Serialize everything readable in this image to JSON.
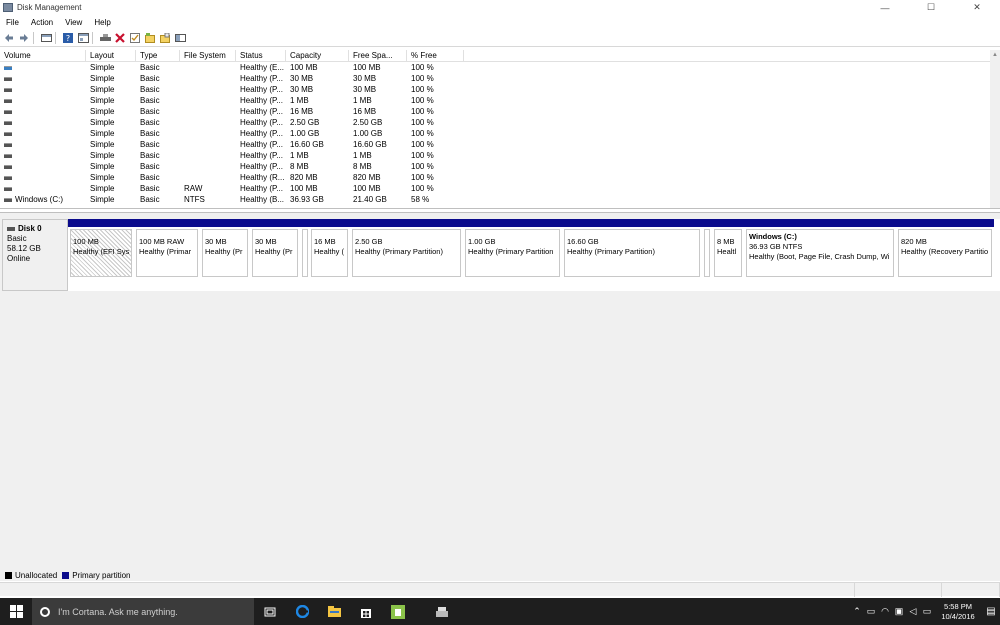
{
  "window": {
    "title": "Disk Management",
    "buttons": [
      "—",
      "☐",
      "✕"
    ]
  },
  "menu": [
    "File",
    "Action",
    "View",
    "Help"
  ],
  "toolbar": {
    "icons": [
      "back-arrow-icon",
      "forward-arrow-icon",
      "separator",
      "disk-list-icon",
      "separator",
      "help-icon",
      "properties-icon",
      "separator",
      "connect-drive-icon",
      "delete-icon",
      "check-icon",
      "new-folder-icon",
      "open-folder-icon",
      "view-icon"
    ]
  },
  "volume_list": {
    "columns": [
      "Volume",
      "Layout",
      "Type",
      "File System",
      "Status",
      "Capacity",
      "Free Spa...",
      "% Free"
    ],
    "rows": [
      {
        "volume": "",
        "layout": "Simple",
        "type": "Basic",
        "fs": "",
        "status": "Healthy (E...",
        "capacity": "100 MB",
        "free": "100 MB",
        "pct": "100 %",
        "icon": "blue"
      },
      {
        "volume": "",
        "layout": "Simple",
        "type": "Basic",
        "fs": "",
        "status": "Healthy (P...",
        "capacity": "30 MB",
        "free": "30 MB",
        "pct": "100 %",
        "icon": "gray"
      },
      {
        "volume": "",
        "layout": "Simple",
        "type": "Basic",
        "fs": "",
        "status": "Healthy (P...",
        "capacity": "30 MB",
        "free": "30 MB",
        "pct": "100 %",
        "icon": "gray"
      },
      {
        "volume": "",
        "layout": "Simple",
        "type": "Basic",
        "fs": "",
        "status": "Healthy (P...",
        "capacity": "1 MB",
        "free": "1 MB",
        "pct": "100 %",
        "icon": "gray"
      },
      {
        "volume": "",
        "layout": "Simple",
        "type": "Basic",
        "fs": "",
        "status": "Healthy (P...",
        "capacity": "16 MB",
        "free": "16 MB",
        "pct": "100 %",
        "icon": "gray"
      },
      {
        "volume": "",
        "layout": "Simple",
        "type": "Basic",
        "fs": "",
        "status": "Healthy (P...",
        "capacity": "2.50 GB",
        "free": "2.50 GB",
        "pct": "100 %",
        "icon": "gray"
      },
      {
        "volume": "",
        "layout": "Simple",
        "type": "Basic",
        "fs": "",
        "status": "Healthy (P...",
        "capacity": "1.00 GB",
        "free": "1.00 GB",
        "pct": "100 %",
        "icon": "gray"
      },
      {
        "volume": "",
        "layout": "Simple",
        "type": "Basic",
        "fs": "",
        "status": "Healthy (P...",
        "capacity": "16.60 GB",
        "free": "16.60 GB",
        "pct": "100 %",
        "icon": "gray"
      },
      {
        "volume": "",
        "layout": "Simple",
        "type": "Basic",
        "fs": "",
        "status": "Healthy (P...",
        "capacity": "1 MB",
        "free": "1 MB",
        "pct": "100 %",
        "icon": "gray"
      },
      {
        "volume": "",
        "layout": "Simple",
        "type": "Basic",
        "fs": "",
        "status": "Healthy (P...",
        "capacity": "8 MB",
        "free": "8 MB",
        "pct": "100 %",
        "icon": "gray"
      },
      {
        "volume": "",
        "layout": "Simple",
        "type": "Basic",
        "fs": "",
        "status": "Healthy (R...",
        "capacity": "820 MB",
        "free": "820 MB",
        "pct": "100 %",
        "icon": "gray"
      },
      {
        "volume": "",
        "layout": "Simple",
        "type": "Basic",
        "fs": "RAW",
        "status": "Healthy (P...",
        "capacity": "100 MB",
        "free": "100 MB",
        "pct": "100 %",
        "icon": "gray"
      },
      {
        "volume": "Windows (C:)",
        "layout": "Simple",
        "type": "Basic",
        "fs": "NTFS",
        "status": "Healthy (B...",
        "capacity": "36.93 GB",
        "free": "21.40 GB",
        "pct": "58 %",
        "icon": "gray"
      }
    ]
  },
  "disk": {
    "name": "Disk 0",
    "type": "Basic",
    "size": "58.12 GB",
    "state": "Online",
    "partitions": [
      {
        "l1": "100 MB",
        "l2": "Healthy (EFI Syst",
        "hatched": true,
        "bold": false
      },
      {
        "l1": "100 MB RAW",
        "l2": "Healthy (Primar",
        "hatched": false,
        "bold": false
      },
      {
        "l1": "30 MB",
        "l2": "Healthy (Pr",
        "hatched": false,
        "bold": false
      },
      {
        "l1": "30 MB",
        "l2": "Healthy (Pr",
        "hatched": false,
        "bold": false
      },
      {
        "l1": "",
        "l2": "",
        "hatched": false,
        "bold": false
      },
      {
        "l1": "16 MB",
        "l2": "Healthy (",
        "hatched": false,
        "bold": false
      },
      {
        "l1": "2.50 GB",
        "l2": "Healthy (Primary Partition)",
        "hatched": false,
        "bold": false
      },
      {
        "l1": "1.00 GB",
        "l2": "Healthy (Primary Partition",
        "hatched": false,
        "bold": false
      },
      {
        "l1": "16.60 GB",
        "l2": "Healthy (Primary Partition)",
        "hatched": false,
        "bold": false
      },
      {
        "l1": "",
        "l2": "",
        "hatched": false,
        "bold": false
      },
      {
        "l1": "8 MB",
        "l2": "Healtl",
        "hatched": false,
        "bold": false
      },
      {
        "title": "Windows  (C:)",
        "l1": "36.93 GB NTFS",
        "l2": "Healthy (Boot, Page File, Crash Dump, Wi",
        "hatched": false,
        "bold": true
      },
      {
        "l1": "820 MB",
        "l2": "Healthy (Recovery Partitio",
        "hatched": false,
        "bold": false
      }
    ]
  },
  "legend": [
    {
      "label": "Unallocated",
      "color": "#000000"
    },
    {
      "label": "Primary partition",
      "color": "#0b0b8c"
    }
  ],
  "taskbar": {
    "search_placeholder": "I'm Cortana. Ask me anything.",
    "icons": [
      "task-view-icon",
      "edge-icon",
      "file-explorer-icon",
      "store-icon",
      "android-icon",
      "disk-management-icon"
    ],
    "tray_icons": [
      "chevron-up-icon",
      "keyboard-icon",
      "wifi-icon",
      "monitor-icon",
      "volume-icon",
      "battery-icon"
    ],
    "time": "5:58 PM",
    "date": "10/4/2016"
  }
}
